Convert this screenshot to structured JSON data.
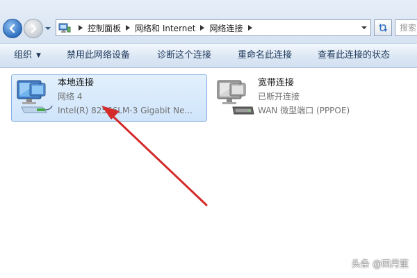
{
  "address": {
    "crumbs": [
      "控制面板",
      "网络和 Internet",
      "网络连接"
    ],
    "search_placeholder": "搜索"
  },
  "toolbar": {
    "organize": "组织",
    "disable_device": "禁用此网络设备",
    "diagnose": "诊断这个连接",
    "rename": "重命名此连接",
    "view_status": "查看此连接的状态"
  },
  "connections": [
    {
      "name": "本地连接",
      "line1": "网络  4",
      "line2": "Intel(R) 82566LM-3 Gigabit Ne...",
      "selected": true
    },
    {
      "name": "宽带连接",
      "line1": "已断开连接",
      "line2": "WAN 微型端口 (PPPOE)",
      "selected": false
    }
  ],
  "watermark": "头条 @四月笙",
  "colors": {
    "arrow": "#d42a2a",
    "selection": "#cfe4fb",
    "command_text": "#1e395b"
  }
}
